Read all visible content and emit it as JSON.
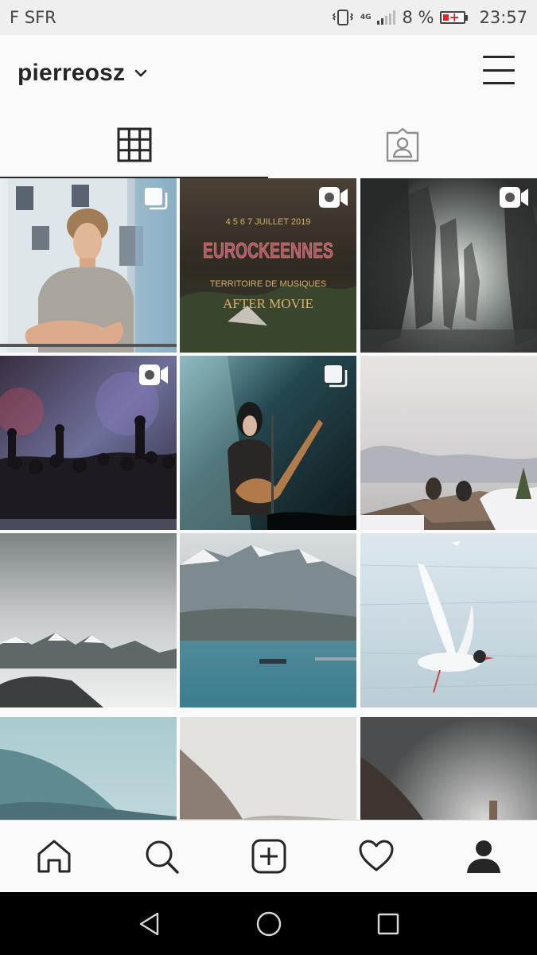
{
  "status_bar": {
    "carrier": "F SFR",
    "network": "4G",
    "battery": "8 %",
    "time": "23:57"
  },
  "header": {
    "username": "pierreosz"
  },
  "tabs": [
    {
      "id": "grid",
      "icon": "grid-icon",
      "active": true
    },
    {
      "id": "tagged",
      "icon": "tagged-person-icon",
      "active": false
    }
  ],
  "posts": [
    {
      "subject": "portrait",
      "badge": "carousel"
    },
    {
      "subject": "festival-poster",
      "badge": "video",
      "poster": {
        "date": "4 5 6 7 JUILLET 2019",
        "title": "EUROCKEENNES",
        "subtitle": "TERRITOIRE DE MUSIQUES",
        "footer": "AFTER MOVIE"
      }
    },
    {
      "subject": "silhouettes",
      "badge": "video"
    },
    {
      "subject": "concert-crowd",
      "badge": "video"
    },
    {
      "subject": "guitarist",
      "badge": "carousel"
    },
    {
      "subject": "people-on-dock",
      "badge": ""
    },
    {
      "subject": "misty-mountains",
      "badge": ""
    },
    {
      "subject": "lake-boat",
      "badge": ""
    },
    {
      "subject": "seagull",
      "badge": ""
    },
    {
      "subject": "blue-hills",
      "badge": ""
    },
    {
      "subject": "cliff",
      "badge": ""
    },
    {
      "subject": "dark-lake",
      "badge": ""
    }
  ],
  "bottom_nav": [
    "home-icon",
    "search-icon",
    "add-post-icon",
    "activity-heart-icon",
    "profile-icon"
  ],
  "system_nav": [
    "back-icon",
    "home-circle-icon",
    "recents-icon"
  ],
  "colors": {
    "text": "#262626",
    "battery_low": "#d62b2b",
    "status_bg": "#efefef",
    "background": "#fafafa"
  }
}
